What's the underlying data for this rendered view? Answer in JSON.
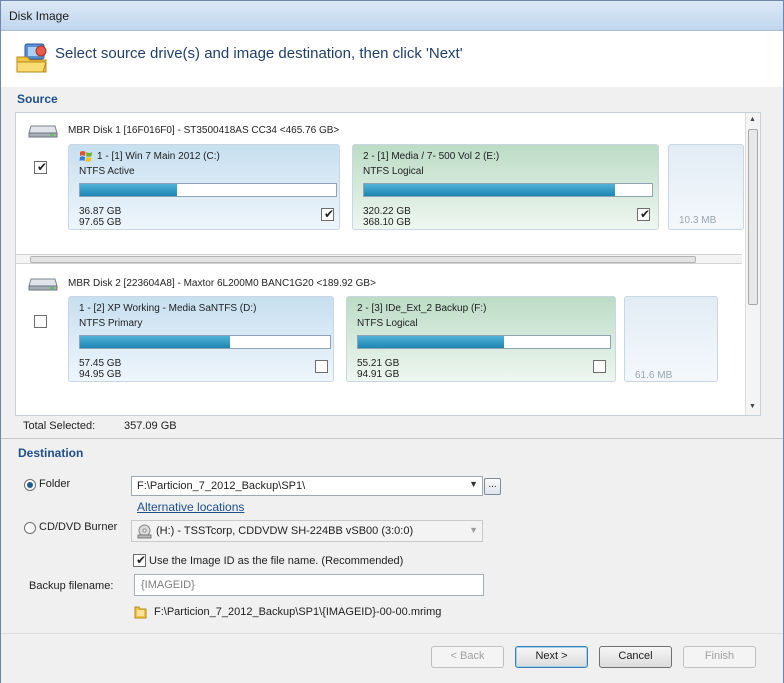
{
  "window": {
    "title": "Disk Image"
  },
  "header": {
    "text": "Select source drive(s) and image destination, then click 'Next'",
    "icon": "disk-image-icon"
  },
  "source": {
    "label": "Source",
    "disks": [
      {
        "title": "MBR Disk 1 [16F016F0] - ST3500418AS CC34  <465.76 GB>",
        "checked": true,
        "partitions": [
          {
            "name": "1 - [1] Win 7 Main 2012 (C:)",
            "type": "NTFS Active",
            "used": "36.87 GB",
            "total": "97.65 GB",
            "fill": 0.38,
            "checked": true,
            "style": "primary",
            "icon": "windows-logo-icon"
          },
          {
            "name": "2 - [1] Media / 7- 500 Vol 2 (E:)",
            "type": "NTFS Logical",
            "used": "320.22 GB",
            "total": "368.10 GB",
            "fill": 0.87,
            "checked": true,
            "style": "logical"
          }
        ],
        "unallocated": "10.3 MB"
      },
      {
        "title": "MBR Disk 2 [223604A8] - Maxtor 6L200M0 BANC1G20  <189.92 GB>",
        "checked": false,
        "partitions": [
          {
            "name": "1 - [2] XP Working - Media SaNTFS (D:)",
            "type": "NTFS Primary",
            "used": "57.45 GB",
            "total": "94.95 GB",
            "fill": 0.6,
            "checked": false,
            "style": "primary"
          },
          {
            "name": "2 - [3] IDe_Ext_2 Backup (F:)",
            "type": "NTFS Logical",
            "used": "55.21 GB",
            "total": "94.91 GB",
            "fill": 0.58,
            "checked": false,
            "style": "logical"
          }
        ],
        "unallocated": "61.6 MB"
      }
    ],
    "total_label": "Total Selected:",
    "total_value": "357.09 GB"
  },
  "destination": {
    "label": "Destination",
    "folder_label": "Folder",
    "folder_selected": true,
    "folder_value": "F:\\Particion_7_2012_Backup\\SP1\\",
    "browse_label": "...",
    "alternative_link": "Alternative locations",
    "burner_label": "CD/DVD Burner",
    "burner_value": "(H:) - TSSTcorp, CDDVDW SH-224BB  vSB00 (3:0:0)",
    "use_image_id_label": "Use the Image ID as the file name.  (Recommended)",
    "use_image_id_checked": true,
    "filename_label": "Backup filename:",
    "filename_value": "{IMAGEID}",
    "full_path": "F:\\Particion_7_2012_Backup\\SP1\\{IMAGEID}-00-00.mrimg"
  },
  "footer": {
    "back": "< Back",
    "next": "Next >",
    "cancel": "Cancel",
    "finish": "Finish"
  }
}
